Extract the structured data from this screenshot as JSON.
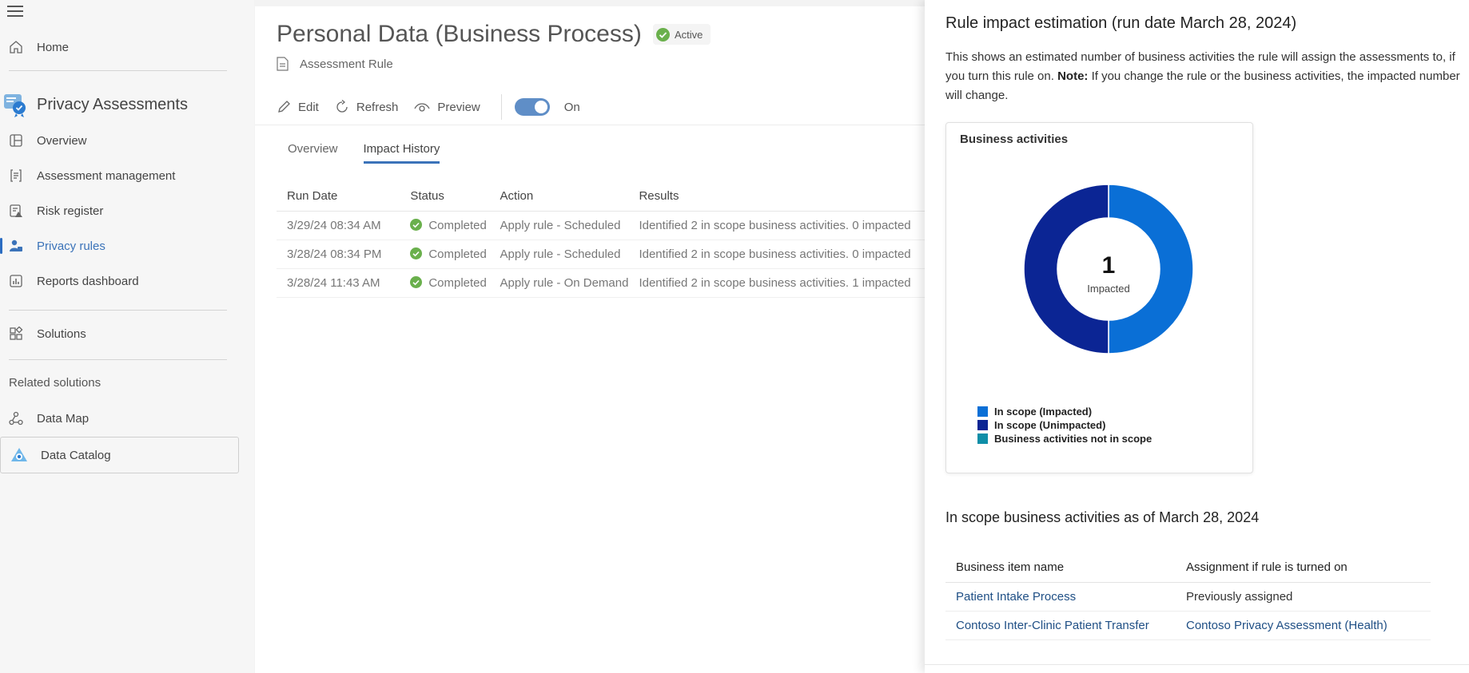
{
  "sidebar": {
    "home": "Home",
    "app_title": "Privacy Assessments",
    "items": [
      {
        "label": "Overview",
        "icon": "overview-icon"
      },
      {
        "label": "Assessment management",
        "icon": "assessment-icon"
      },
      {
        "label": "Risk register",
        "icon": "risk-icon"
      },
      {
        "label": "Privacy rules",
        "icon": "privacy-rules-icon",
        "active": true
      },
      {
        "label": "Reports dashboard",
        "icon": "reports-icon"
      }
    ],
    "solutions": "Solutions",
    "related_label": "Related solutions",
    "data_map": "Data Map",
    "data_catalog": "Data Catalog"
  },
  "page": {
    "title": "Personal Data (Business Process)",
    "status": "Active",
    "subtitle": "Assessment Rule"
  },
  "toolbar": {
    "edit": "Edit",
    "refresh": "Refresh",
    "preview": "Preview",
    "toggle_label": "On"
  },
  "tabs": {
    "overview": "Overview",
    "impact_history": "Impact History"
  },
  "history": {
    "headers": [
      "Run Date",
      "Status",
      "Action",
      "Results"
    ],
    "rows": [
      {
        "date": "3/29/24 08:34 AM",
        "status": "Completed",
        "action": "Apply rule - Scheduled",
        "results": "Identified 2 in scope business activities. 0 impacted"
      },
      {
        "date": "3/28/24 08:34 PM",
        "status": "Completed",
        "action": "Apply rule - Scheduled",
        "results": "Identified 2 in scope business activities. 0 impacted"
      },
      {
        "date": "3/28/24 11:43 AM",
        "status": "Completed",
        "action": "Apply rule - On Demand",
        "results": "Identified 2 in scope business activities. 1 impacted"
      }
    ]
  },
  "panel": {
    "title": "Rule impact estimation (run date March 28, 2024)",
    "desc_part1": "This shows an estimated number of business activities the rule will assign the assessments to, if you turn this rule on. ",
    "desc_note": "Note:",
    "desc_part2": " If you change the rule or the business activities, the impacted number will change.",
    "chart_title": "Business activities",
    "center_value": "1",
    "center_label": "Impacted",
    "section_title": "In scope business activities as of March 28, 2024",
    "table_headers": [
      "Business item name",
      "Assignment if rule is turned on"
    ],
    "table_rows": [
      {
        "name": "Patient Intake Process",
        "assignment": "Previously assigned",
        "assignment_link": false
      },
      {
        "name": "Contoso Inter-Clinic Patient Transfer",
        "assignment": "Contoso Privacy Assessment (Health)",
        "assignment_link": true
      }
    ]
  },
  "colors": {
    "accent": "#3b73b9",
    "impacted": "#0a6fd6",
    "unimpacted": "#0b2594",
    "not_in_scope": "#0f8ea8",
    "success": "#6ab04c"
  },
  "chart_data": {
    "type": "pie",
    "title": "Business activities",
    "categories": [
      "In scope (Impacted)",
      "In scope (Unimpacted)",
      "Business activities not in scope"
    ],
    "values": [
      1,
      1,
      0
    ],
    "colors": [
      "#0a6fd6",
      "#0b2594",
      "#0f8ea8"
    ],
    "legend": "bottom-left"
  }
}
